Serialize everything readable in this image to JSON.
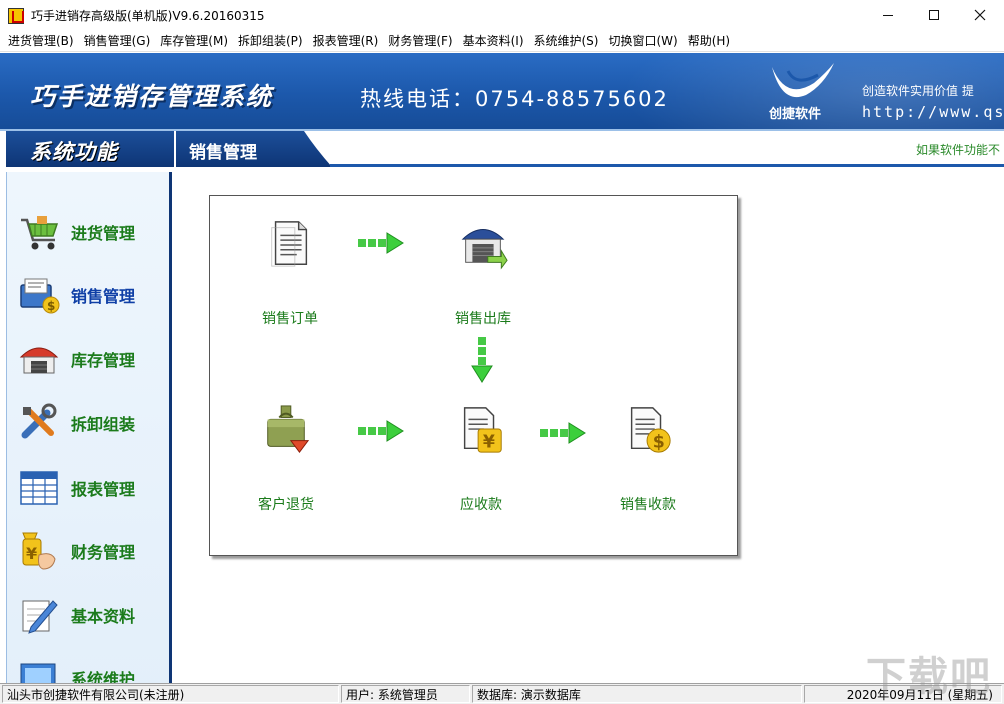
{
  "window": {
    "title": "巧手进销存高级版(单机版)V9.6.20160315",
    "controls": {
      "minimize": "minimize-icon",
      "maximize": "maximize-icon",
      "close": "close-icon"
    }
  },
  "menu": [
    "进货管理(B)",
    "销售管理(G)",
    "库存管理(M)",
    "拆卸组装(P)",
    "报表管理(R)",
    "财务管理(F)",
    "基本资料(I)",
    "系统维护(S)",
    "切换窗口(W)",
    "帮助(H)"
  ],
  "banner": {
    "title": "巧手进销存管理系统",
    "hotline": "热线电话：0754-88575602",
    "brand_name": "创捷软件",
    "slogan": "创造软件实用价值  提",
    "website": "http://www.qs"
  },
  "section": {
    "left_title": "系统功能",
    "current": "销售管理",
    "marquee": "如果软件功能不"
  },
  "sidebar": {
    "items": [
      {
        "label": "进货管理",
        "icon": "shopping-cart-icon",
        "active": false
      },
      {
        "label": "销售管理",
        "icon": "sales-document-icon",
        "active": true
      },
      {
        "label": "库存管理",
        "icon": "warehouse-icon",
        "active": false
      },
      {
        "label": "拆卸组装",
        "icon": "tools-icon",
        "active": false
      },
      {
        "label": "报表管理",
        "icon": "spreadsheet-icon",
        "active": false
      },
      {
        "label": "财务管理",
        "icon": "yuan-hand-icon",
        "active": false
      },
      {
        "label": "基本资料",
        "icon": "pencil-note-icon",
        "active": false
      },
      {
        "label": "系统维护",
        "icon": "system-icon",
        "active": false
      }
    ]
  },
  "flow": {
    "nodes": {
      "sales_order": "销售订单",
      "sales_outbound": "销售出库",
      "customer_return": "客户退货",
      "receivable": "应收款",
      "sales_collection": "销售收款"
    }
  },
  "status": {
    "company": "汕头市创捷软件有限公司(未注册)",
    "user": "用户: 系统管理员",
    "database": "数据库: 演示数据库",
    "date": "2020年09月11日 (星期五)"
  },
  "watermark": "下载吧",
  "colors": {
    "banner_blue": "#1c58ab",
    "dark_navy": "#0e3575",
    "label_green": "#1b7b1b",
    "active_blue": "#0f3fa6",
    "arrow_green": "#3ccf3c"
  }
}
